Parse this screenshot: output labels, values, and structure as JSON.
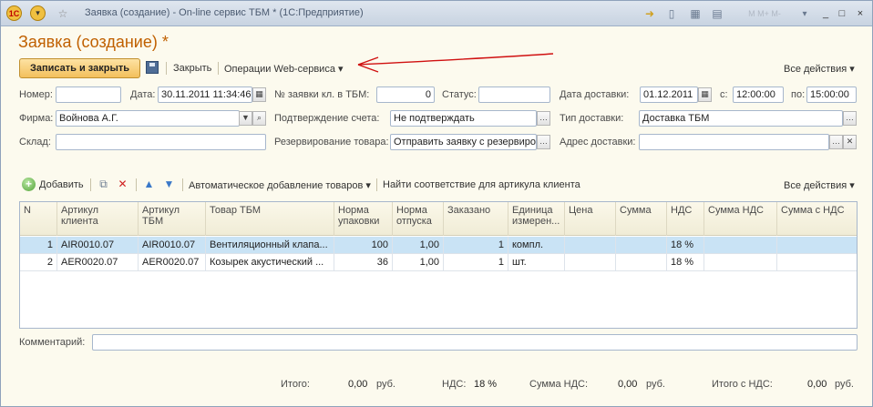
{
  "window": {
    "title": "Заявка (создание) - On-line сервис ТБМ *  (1С:Предприятие)",
    "app_badge": "1С",
    "win_controls": [
      "_",
      "□",
      "×"
    ]
  },
  "page_title": "Заявка (создание) *",
  "toolbar": {
    "save_close": "Записать и закрыть",
    "close": "Закрыть",
    "web_ops": "Операции Web-сервиса ▾",
    "all_actions": "Все действия ▾"
  },
  "form": {
    "number_label": "Номер:",
    "number_value": "",
    "date_label": "Дата:",
    "date_value": "30.11.2011 11:34:46",
    "req_no_label": "№ заявки кл. в ТБМ:",
    "req_no_value": "0",
    "status_label": "Статус:",
    "status_value": "",
    "delivery_date_label": "Дата доставки:",
    "delivery_date_value": "01.12.2011",
    "from_label": "с:",
    "from_value": "12:00:00",
    "to_label": "по:",
    "to_value": "15:00:00",
    "firm_label": "Фирма:",
    "firm_value": "Войнова А.Г.",
    "invoice_confirm_label": "Подтверждение счета:",
    "invoice_confirm_value": "Не подтверждать",
    "delivery_type_label": "Тип доставки:",
    "delivery_type_value": "Доставка ТБМ",
    "warehouse_label": "Склад:",
    "warehouse_value": "",
    "reserve_label": "Резервирование товара:",
    "reserve_value": "Отправить заявку с резервиро",
    "address_label": "Адрес доставки:",
    "address_value": ""
  },
  "items_toolbar": {
    "add": "Добавить",
    "auto_add": "Автоматическое добавление товаров ▾",
    "find_match": "Найти соответствие для артикула клиента",
    "all_actions": "Все действия ▾"
  },
  "table": {
    "columns": [
      "N",
      "Артикул клиента",
      "Артикул ТБМ",
      "Товар ТБМ",
      "Норма упаковки",
      "Норма отпуска",
      "Заказано",
      "Единица измерен...",
      "Цена",
      "Сумма",
      "НДС",
      "Сумма НДС",
      "Сумма с НДС"
    ],
    "rows": [
      [
        "1",
        "AIR0010.07",
        "AIR0010.07",
        "Вентиляционный клапа...",
        "100",
        "1,00",
        "1",
        "компл.",
        "",
        "",
        "18 %",
        "",
        ""
      ],
      [
        "2",
        "AER0020.07",
        "AER0020.07",
        "Козырек акустический ...",
        "36",
        "1,00",
        "1",
        "шт.",
        "",
        "",
        "18 %",
        "",
        ""
      ]
    ]
  },
  "footer": {
    "comment_label": "Комментарий:",
    "total_label": "Итого:",
    "total_value": "0,00",
    "currency1": "руб.",
    "vat_label": "НДС:",
    "vat_value": "18 %",
    "vat_sum_label": "Сумма НДС:",
    "vat_sum_value": "0,00",
    "currency2": "руб.",
    "total_vat_label": "Итого с НДС:",
    "total_vat_value": "0,00",
    "currency3": "руб."
  },
  "colors": {
    "title": "#c06000",
    "accent_button": "#f3c05c",
    "selected_row": "#c9e3f5",
    "arrow": "#d01010"
  }
}
